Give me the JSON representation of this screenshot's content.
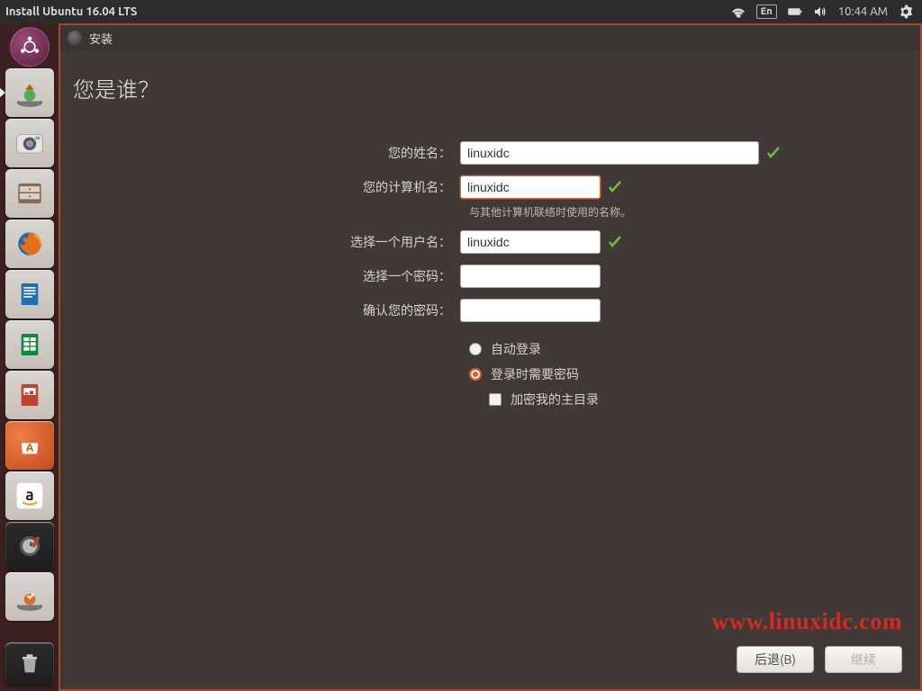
{
  "panel": {
    "title": "Install Ubuntu 16.04 LTS",
    "lang_indicator": "En",
    "time": "10:44 AM"
  },
  "launcher": {
    "items": [
      {
        "name": "dash"
      },
      {
        "name": "ubiquity"
      },
      {
        "name": "shotwell"
      },
      {
        "name": "files"
      },
      {
        "name": "firefox"
      },
      {
        "name": "writer"
      },
      {
        "name": "calc"
      },
      {
        "name": "impress"
      },
      {
        "name": "software-center"
      },
      {
        "name": "amazon"
      },
      {
        "name": "settings"
      },
      {
        "name": "ubiquity2"
      }
    ],
    "trash": "trash"
  },
  "window": {
    "title": "安装"
  },
  "installer": {
    "heading": "您是谁？",
    "labels": {
      "name": "您的姓名：",
      "hostname": "您的计算机名：",
      "hostname_help": "与其他计算机联络时使用的名称。",
      "username": "选择一个用户名：",
      "password": "选择一个密码：",
      "confirm": "确认您的密码："
    },
    "values": {
      "name": "linuxidc",
      "hostname": "linuxidc",
      "username": "linuxidc",
      "password": "",
      "confirm": ""
    },
    "options": {
      "auto_login": "自动登录",
      "require_password": "登录时需要密码",
      "encrypt_home": "加密我的主目录"
    },
    "buttons": {
      "back": "后退(B)",
      "continue": "继续"
    }
  },
  "watermark": "www.linuxidc.com"
}
